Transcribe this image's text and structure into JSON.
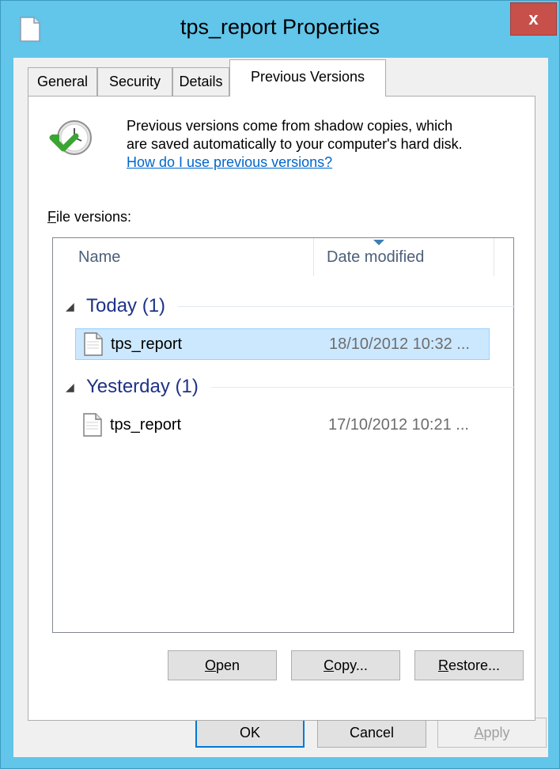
{
  "window": {
    "title": "tps_report Properties",
    "close_label": "x"
  },
  "tabs": [
    {
      "label": "General",
      "active": false
    },
    {
      "label": "Security",
      "active": false
    },
    {
      "label": "Details",
      "active": false
    },
    {
      "label": "Previous Versions",
      "active": true
    }
  ],
  "intro": {
    "line1": "Previous versions come from shadow copies, which",
    "line2": "are saved automatically to your computer's hard disk.",
    "link": "How do I use previous versions?"
  },
  "file_versions": {
    "label_mnemonic": "F",
    "label_rest": "ile versions:",
    "columns": {
      "name": "Name",
      "date": "Date modified"
    },
    "groups": [
      {
        "title": "Today (1)",
        "items": [
          {
            "name": "tps_report",
            "date": "18/10/2012 10:32 ...",
            "selected": true
          }
        ]
      },
      {
        "title": "Yesterday (1)",
        "items": [
          {
            "name": "tps_report",
            "date": "17/10/2012 10:21 ...",
            "selected": false
          }
        ]
      }
    ]
  },
  "actions": {
    "open": {
      "mnemonic": "O",
      "rest": "pen"
    },
    "copy": {
      "mnemonic": "C",
      "rest": "opy..."
    },
    "restore": {
      "mnemonic": "R",
      "rest": "estore..."
    }
  },
  "dialog_buttons": {
    "ok": "OK",
    "cancel": "Cancel",
    "apply_mnemonic": "A",
    "apply_rest": "pply"
  },
  "colors": {
    "window_frame": "#62c5ea",
    "close_button": "#c7504a",
    "selection": "#cce8ff",
    "link": "#0066cc",
    "group_title": "#1e3287"
  },
  "icons": {
    "title": "document-icon",
    "intro": "restore-clock-icon",
    "file": "document-icon",
    "sort": "sort-descending-icon"
  }
}
